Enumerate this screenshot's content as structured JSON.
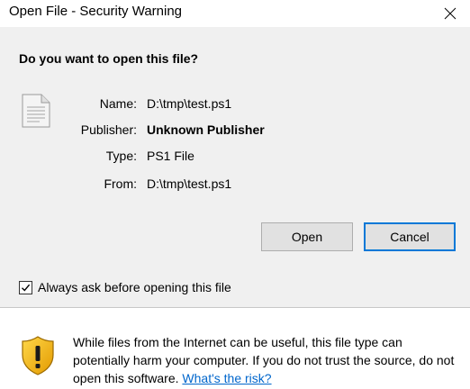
{
  "window": {
    "title": "Open File - Security Warning"
  },
  "dialog": {
    "heading": "Do you want to open this file?",
    "file": {
      "name_label": "Name:",
      "name_value": "D:\\tmp\\test.ps1",
      "publisher_label": "Publisher:",
      "publisher_value": "Unknown Publisher",
      "type_label": "Type:",
      "type_value": "PS1 File",
      "from_label": "From:",
      "from_value": "D:\\tmp\\test.ps1"
    },
    "buttons": {
      "open_label": "Open",
      "cancel_label": "Cancel"
    },
    "checkbox": {
      "label": "Always ask before opening this file",
      "checked": true
    },
    "warning": {
      "text": "While files from the Internet can be useful, this file type can potentially harm your computer. If you do not trust the source, do not open this software. ",
      "link_text": "What's the risk?"
    }
  },
  "colors": {
    "accent": "#0078d7",
    "link": "#0066cc",
    "shield": "#f2b705"
  },
  "icons": {
    "close": "close-icon",
    "file": "file-icon",
    "checkmark": "checkmark-icon",
    "shield": "shield-warning-icon"
  }
}
